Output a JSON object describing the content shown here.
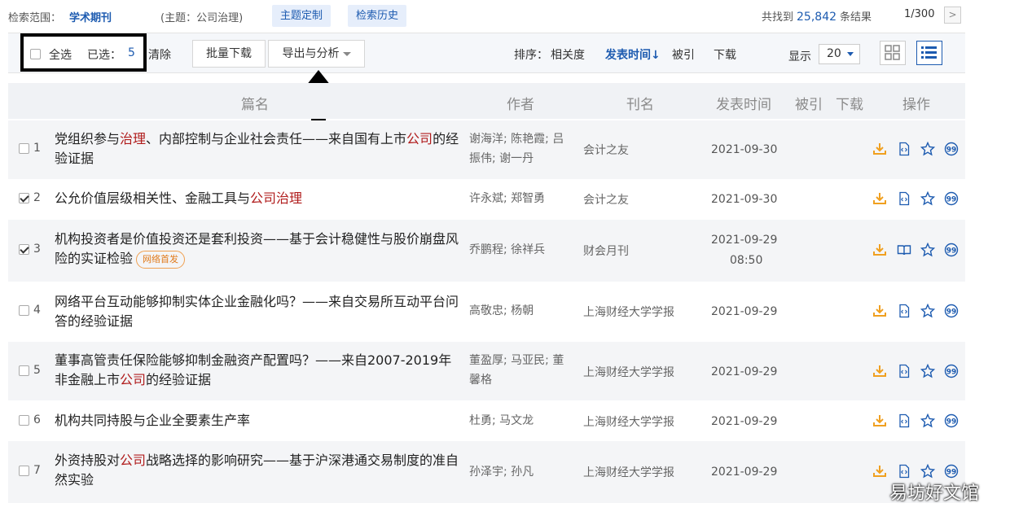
{
  "top": {
    "scope_label": "检索范围：",
    "scope_value": "学术期刊",
    "topic": "(主题：公司治理)",
    "pill_custom": "主题定制",
    "pill_history": "检索历史",
    "found_prefix": "共找到",
    "found_count": "25,842",
    "found_suffix": "条结果",
    "pages": "1/300",
    "next": ">"
  },
  "toolbar": {
    "select_all": "全选",
    "selected_label": "已选：",
    "selected_count": "5",
    "clear": "清除",
    "batch_download": "批量下载",
    "export_analyze": "导出与分析",
    "sort_label": "排序：",
    "sort_relevance": "相关度",
    "sort_date": "发表时间↓",
    "sort_cited": "被引",
    "sort_download": "下载",
    "display_label": "显示",
    "display_value": "20"
  },
  "columns": {
    "title": "篇名",
    "author": "作者",
    "source": "刊名",
    "date": "发表时间",
    "cited": "被引",
    "download": "下载",
    "ops": "操作"
  },
  "badge_text": "网络首发",
  "rows": [
    {
      "num": "1",
      "t1": "党组织参与",
      "h1": "治理",
      "t2": "、内部控制与企业社会责任——来自国有上市",
      "h2": "公司",
      "t3": "的经验证据",
      "author": "谢海洋; 陈艳霞; 吕振伟; 谢一丹",
      "source": "会计之友",
      "date": "2021-09-30",
      "time": "",
      "checked": false
    },
    {
      "num": "2",
      "t1": "公允价值层级相关性、金融工具与",
      "h1": "公司治理",
      "t2": "",
      "h2": "",
      "t3": "",
      "author": "许永斌; 郑智勇",
      "source": "会计之友",
      "date": "2021-09-30",
      "time": "",
      "checked": true
    },
    {
      "num": "3",
      "t1": "机构投资者是价值投资还是套利投资——基于会计稳健性与股价崩盘风险的实证检验",
      "h1": "",
      "t2": "",
      "h2": "",
      "t3": "",
      "author": "乔鹏程; 徐祥兵",
      "source": "财会月刊",
      "date": "2021-09-29",
      "time": "08:50",
      "checked": true
    },
    {
      "num": "4",
      "t1": "网络平台互动能够抑制实体企业金融化吗？——来自交易所互动平台问答的经验证据",
      "h1": "",
      "t2": "",
      "h2": "",
      "t3": "",
      "author": "高敬忠; 杨朝",
      "source": "上海财经大学学报",
      "date": "2021-09-29",
      "time": "",
      "checked": false
    },
    {
      "num": "5",
      "t1": "董事高管责任保险能够抑制金融资产配置吗？——来自2007-2019年非金融上市",
      "h1": "公司",
      "t2": "的经验证据",
      "h2": "",
      "t3": "",
      "author": "董盈厚; 马亚民; 董馨格",
      "source": "上海财经大学学报",
      "date": "2021-09-29",
      "time": "",
      "checked": false
    },
    {
      "num": "6",
      "t1": "机构共同持股与企业全要素生产率",
      "h1": "",
      "t2": "",
      "h2": "",
      "t3": "",
      "author": "杜勇; 马文龙",
      "source": "上海财经大学学报",
      "date": "2021-09-29",
      "time": "",
      "checked": false
    },
    {
      "num": "7",
      "t1": "外资持股对",
      "h1": "公司",
      "t2": "战略选择的影响研究——基于沪深港通交易制度的准自然实验",
      "h2": "",
      "t3": "",
      "author": "孙泽宇; 孙凡",
      "source": "上海财经大学学报",
      "date": "2021-09-29",
      "time": "",
      "checked": false
    }
  ],
  "watermark": "易坊好文馆",
  "colors": {
    "link": "#1d5bb0",
    "highlight": "#b01c1c",
    "download_icon": "#f0a020",
    "action_icon": "#1d5bb0"
  }
}
